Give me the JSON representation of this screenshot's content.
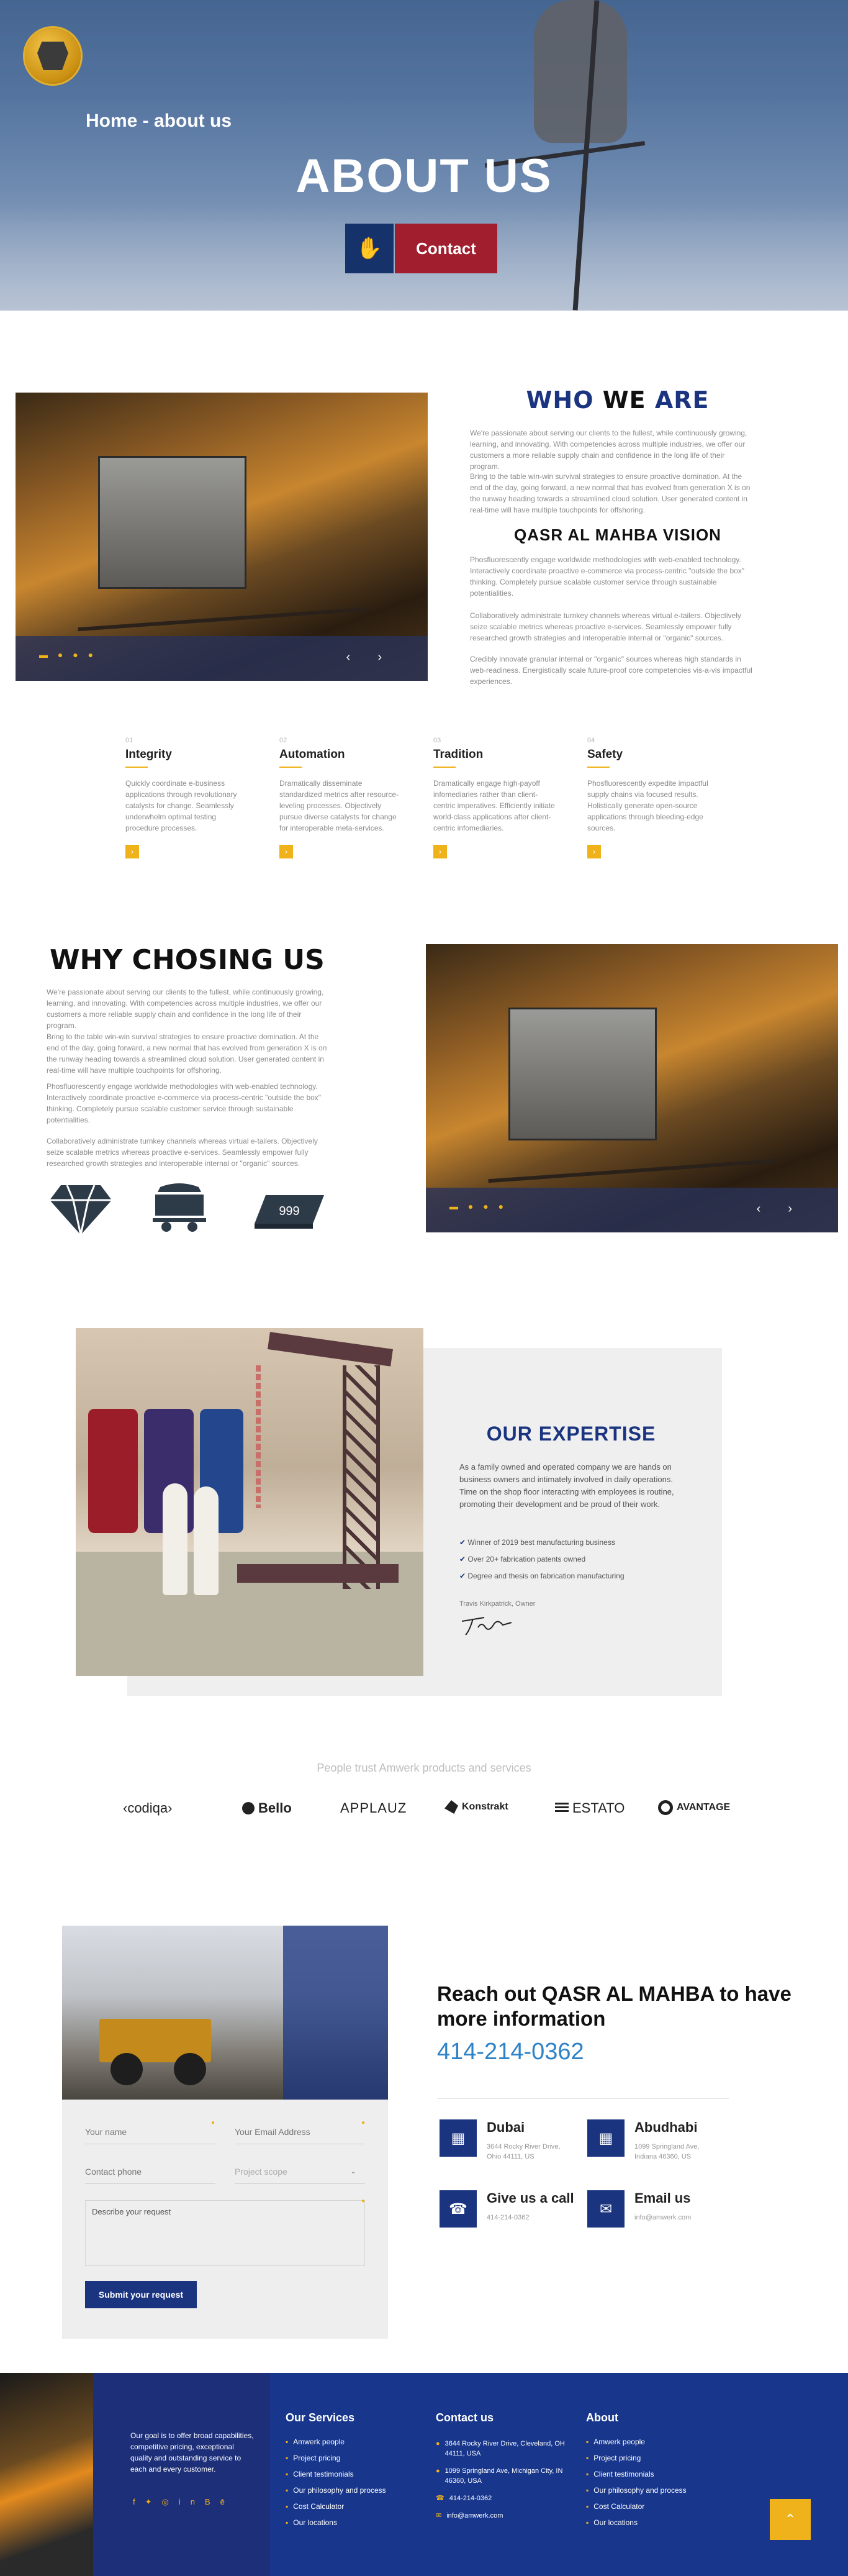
{
  "hero": {
    "breadcrumb": "Home - about us",
    "title": "ABOUT US",
    "contact_button": "Contact"
  },
  "who": {
    "title_a": "WHO ",
    "title_b": "WE",
    "title_c": " ARE",
    "para1": "We're passionate about serving our clients to the fullest, while continuously growing, learning, and innovating. With competencies across multiple industries, we offer our customers a more reliable supply chain and confidence in the long life of their program.",
    "para2": "Bring to the table win-win survival strategies to ensure proactive domination. At the end of the day, going forward, a new normal that has evolved from generation X is on the runway heading towards a streamlined cloud solution. User generated content in real-time will have multiple touchpoints for offshoring.",
    "vision_title": "QASR AL MAHBA VISION",
    "para3": "Phosfluorescently engage worldwide methodologies with web-enabled technology. Interactively coordinate proactive e-commerce via process-centric \"outside the box\" thinking. Completely pursue scalable customer service through sustainable potentialities.",
    "para4": "Collaboratively administrate turnkey channels whereas virtual e-tailers. Objectively seize scalable metrics whereas proactive e-services. Seamlessly empower fully researched growth strategies and interoperable internal or \"organic\" sources.",
    "para5": "Credibly innovate granular internal or \"organic\" sources whereas high standards in web-readiness. Energistically scale future-proof core competencies vis-a-vis impactful experiences."
  },
  "values": [
    {
      "num": "01",
      "title": "Integrity",
      "text": "Quickly coordinate e-business applications through revolutionary catalysts for change. Seamlessly underwhelm optimal testing procedure processes."
    },
    {
      "num": "02",
      "title": "Automation",
      "text": "Dramatically disseminate standardized metrics after resource-leveling processes. Objectively pursue diverse catalysts for change for interoperable meta-services."
    },
    {
      "num": "03",
      "title": "Tradition",
      "text": "Dramatically engage high-payoff infomediaries rather than client-centric imperatives. Efficiently initiate world-class applications after client-centric infomediaries."
    },
    {
      "num": "04",
      "title": "Safety",
      "text": "Phosfluorescently expedite impactful supply chains via focused results. Holistically generate open-source applications through bleeding-edge sources."
    }
  ],
  "why": {
    "title": "WHY CHOSING US",
    "para1": "We're passionate about serving our clients to the fullest, while continuously growing, learning, and innovating. With competencies across multiple industries, we offer our customers a more reliable supply chain and confidence in the long life of their program.",
    "para2": "Bring to the table win-win survival strategies to ensure proactive domination. At the end of the day, going forward, a new normal that has evolved from generation X is on the runway heading towards a streamlined cloud solution. User generated content in real-time will have multiple touchpoints for offshoring.",
    "para3": "Phosfluorescently engage worldwide methodologies with web-enabled technology. Interactively coordinate proactive e-commerce via process-centric \"outside the box\" thinking. Completely pursue scalable customer service through sustainable potentialities.",
    "para4": "Collaboratively administrate turnkey channels whereas virtual e-tailers. Objectively seize scalable metrics whereas proactive e-services. Seamlessly empower fully researched growth strategies and interoperable internal or \"organic\" sources.",
    "ingot_label": "999"
  },
  "expertise": {
    "title": "OUR EXPERTISE",
    "text": "As a family owned and operated company we are hands on business owners and intimately involved in daily operations. Time on the shop floor interacting with employees is routine, promoting their development and be proud of their work.",
    "checks": [
      "Winner of 2019 best manufacturing business",
      "Over 20+ fabrication patents owned",
      "Degree and thesis on fabrication manufacturing"
    ],
    "signer": "Travis Kirkpatrick, Owner"
  },
  "trust": {
    "heading": "People trust Amwerk products and services",
    "brands": [
      "‹codiqa›",
      "Bello",
      "APPLAUZ",
      "Konstrakt",
      "ESTATO",
      "AVANTAGE"
    ]
  },
  "form": {
    "name_ph": "Your name",
    "email_ph": "Your Email Address",
    "phone_ph": "Contact phone",
    "scope_ph": "Project scope",
    "request_ph": "Describe your request",
    "submit": "Submit your request"
  },
  "contact": {
    "heading": "Reach out QASR AL MAHBA to have more information",
    "phone": "414-214-0362",
    "cards": [
      {
        "title": "Dubai",
        "line1": "3644 Rocky River Drive,",
        "line2": "Ohio 44111, US"
      },
      {
        "title": "Abudhabi",
        "line1": "1099 Springland Ave,",
        "line2": "Indiana 46360, US"
      },
      {
        "title": "Give us a call",
        "line1": "414-214-0362",
        "line2": ""
      },
      {
        "title": "Email us",
        "line1": "info@amwerk.com",
        "line2": ""
      }
    ]
  },
  "footer": {
    "about_text": "Our goal is to offer broad capabilities, competitive pricing, exceptional quality and outstanding service to each and every customer.",
    "services_title": "Our Services",
    "services": [
      "Amwerk people",
      "Project pricing",
      "Client testimonials",
      "Our philosophy and process",
      "Cost Calculator",
      "Our locations"
    ],
    "contact_title": "Contact us",
    "contact_lines": [
      "3644 Rocky River Drive, Cleveland, OH 44111, USA",
      "1099 Springland Ave, Michigan City, IN 46360, USA",
      "414-214-0362",
      "info@amwerk.com"
    ],
    "about_title": "About",
    "about_links": [
      "Amwerk people",
      "Project pricing",
      "Client testimonials",
      "Our philosophy and process",
      "Cost Calculator",
      "Our locations"
    ]
  }
}
